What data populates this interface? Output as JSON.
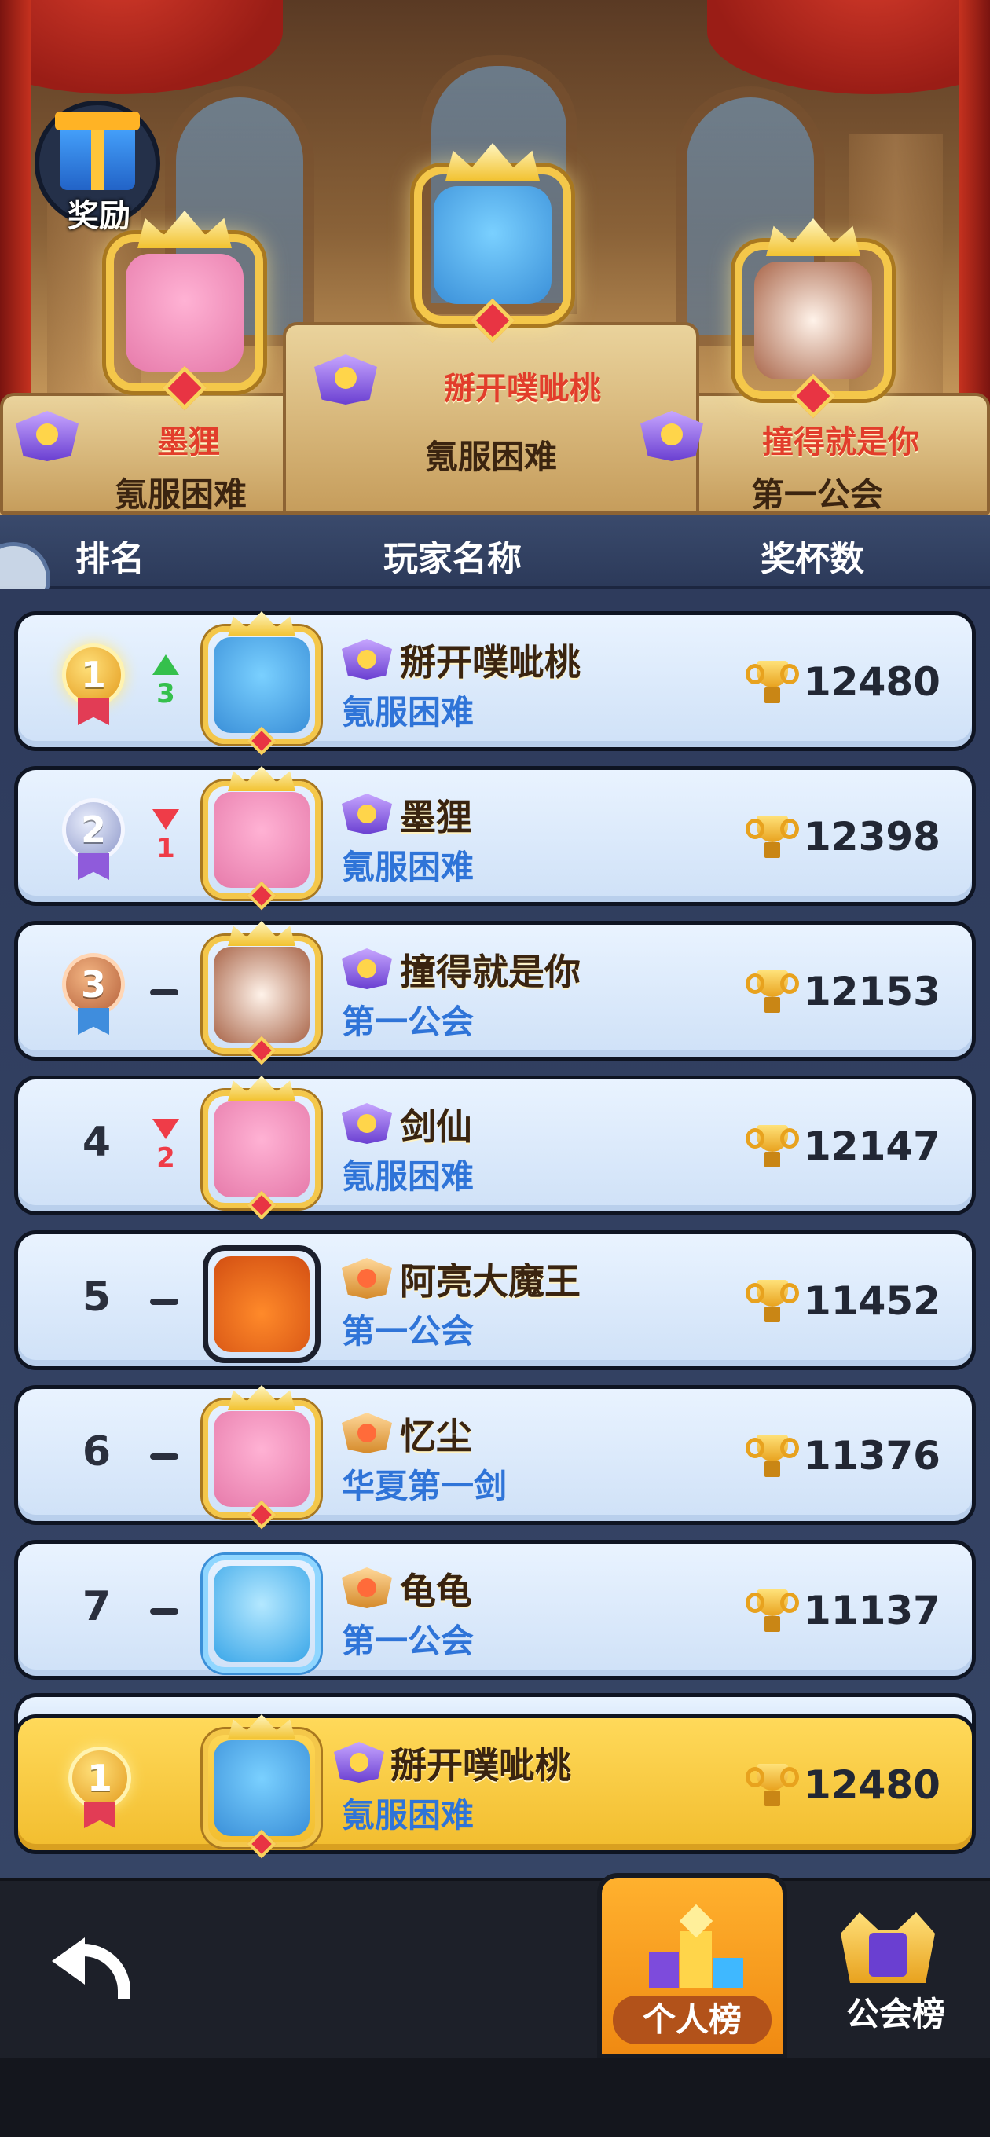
{
  "reward_button": {
    "label": "奖励",
    "icon": "gift-icon"
  },
  "podium": {
    "first": {
      "name": "掰开噗呲桃",
      "guild": "氪服困难",
      "avatar": "blue-bird"
    },
    "second": {
      "name": "墨狸",
      "guild": "氪服困难",
      "avatar": "pink-fox"
    },
    "third": {
      "name": "撞得就是你",
      "guild": "第一公会",
      "avatar": "bulldog"
    }
  },
  "table_header": {
    "rank": "排名",
    "player": "玩家名称",
    "trophies": "奖杯数"
  },
  "rows": [
    {
      "rank": "1",
      "medal": "gold",
      "change": "3",
      "dir": "up",
      "name": "掰开噗呲桃",
      "guild": "氪服困难",
      "trophies": "12480"
    },
    {
      "rank": "2",
      "medal": "silver",
      "change": "1",
      "dir": "down",
      "name": "墨狸",
      "guild": "氪服困难",
      "trophies": "12398"
    },
    {
      "rank": "3",
      "medal": "bronze",
      "change": "",
      "dir": "none",
      "name": "撞得就是你",
      "guild": "第一公会",
      "trophies": "12153"
    },
    {
      "rank": "4",
      "medal": "",
      "change": "2",
      "dir": "down",
      "name": "剑仙",
      "guild": "氪服困难",
      "trophies": "12147"
    },
    {
      "rank": "5",
      "medal": "",
      "change": "",
      "dir": "none",
      "name": "阿亮大魔王",
      "guild": "第一公会",
      "trophies": "11452"
    },
    {
      "rank": "6",
      "medal": "",
      "change": "",
      "dir": "none",
      "name": "忆尘",
      "guild": "华夏第一剑",
      "trophies": "11376"
    },
    {
      "rank": "7",
      "medal": "",
      "change": "",
      "dir": "none",
      "name": "龟龟",
      "guild": "第一公会",
      "trophies": "11137"
    }
  ],
  "my_row": {
    "rank": "1",
    "name": "掰开噗呲桃",
    "guild": "氪服困难",
    "trophies": "12480"
  },
  "bottom_nav": {
    "personal": "个人榜",
    "guild": "公会榜"
  },
  "colors": {
    "accent": "#f2bd2e",
    "up": "#35c04c",
    "down": "#ef3c48",
    "guild_text": "#2f74d8"
  }
}
